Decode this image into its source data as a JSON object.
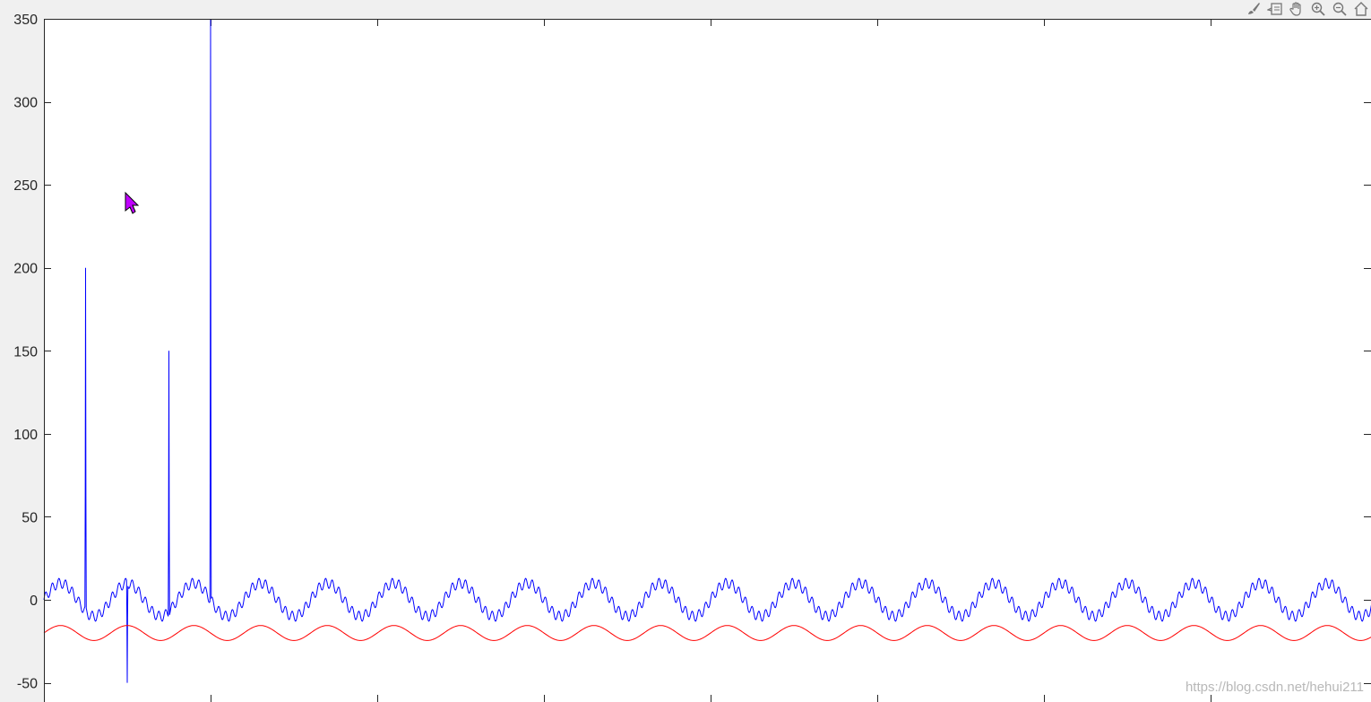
{
  "toolbar": {
    "icons": [
      "brush-icon",
      "datatip-icon",
      "pan-hand-icon",
      "zoom-in-icon",
      "zoom-out-icon",
      "home-icon"
    ]
  },
  "watermark": "https://blog.csdn.net/hehui211",
  "colors": {
    "series_blue": "#0000ff",
    "series_red": "#ff0000",
    "axes": "#262626",
    "figure_bg": "#f0f0f0"
  },
  "chart_data": {
    "type": "line",
    "title": "",
    "xlabel": "",
    "ylabel": "",
    "ylim": [
      -50,
      350
    ],
    "yticks": [
      -50,
      0,
      50,
      100,
      150,
      200,
      250,
      300,
      350
    ],
    "ytick_labels": [
      "-50",
      "0",
      "50",
      "100",
      "150",
      "200",
      "250",
      "300",
      "350"
    ],
    "xlim": [
      0,
      8
    ],
    "xticks": [
      0,
      1,
      2,
      3,
      4,
      5,
      6,
      7,
      8
    ],
    "xtick_labels": [],
    "grid": false,
    "legend": "none",
    "series": [
      {
        "color": "#0000ff",
        "baseline": 0,
        "wave": {
          "period": 0.4,
          "amplitude": 10,
          "ripple_period": 0.04,
          "ripple_amplitude": 3
        },
        "spikes": [
          {
            "x": 0.25,
            "y": 200
          },
          {
            "x": 0.5,
            "y": -50
          },
          {
            "x": 0.75,
            "y": 150
          },
          {
            "x": 1.0,
            "y": 350
          }
        ]
      },
      {
        "color": "#ff0000",
        "baseline": -20,
        "wave": {
          "period": 0.4,
          "amplitude": 4.5
        }
      }
    ]
  }
}
